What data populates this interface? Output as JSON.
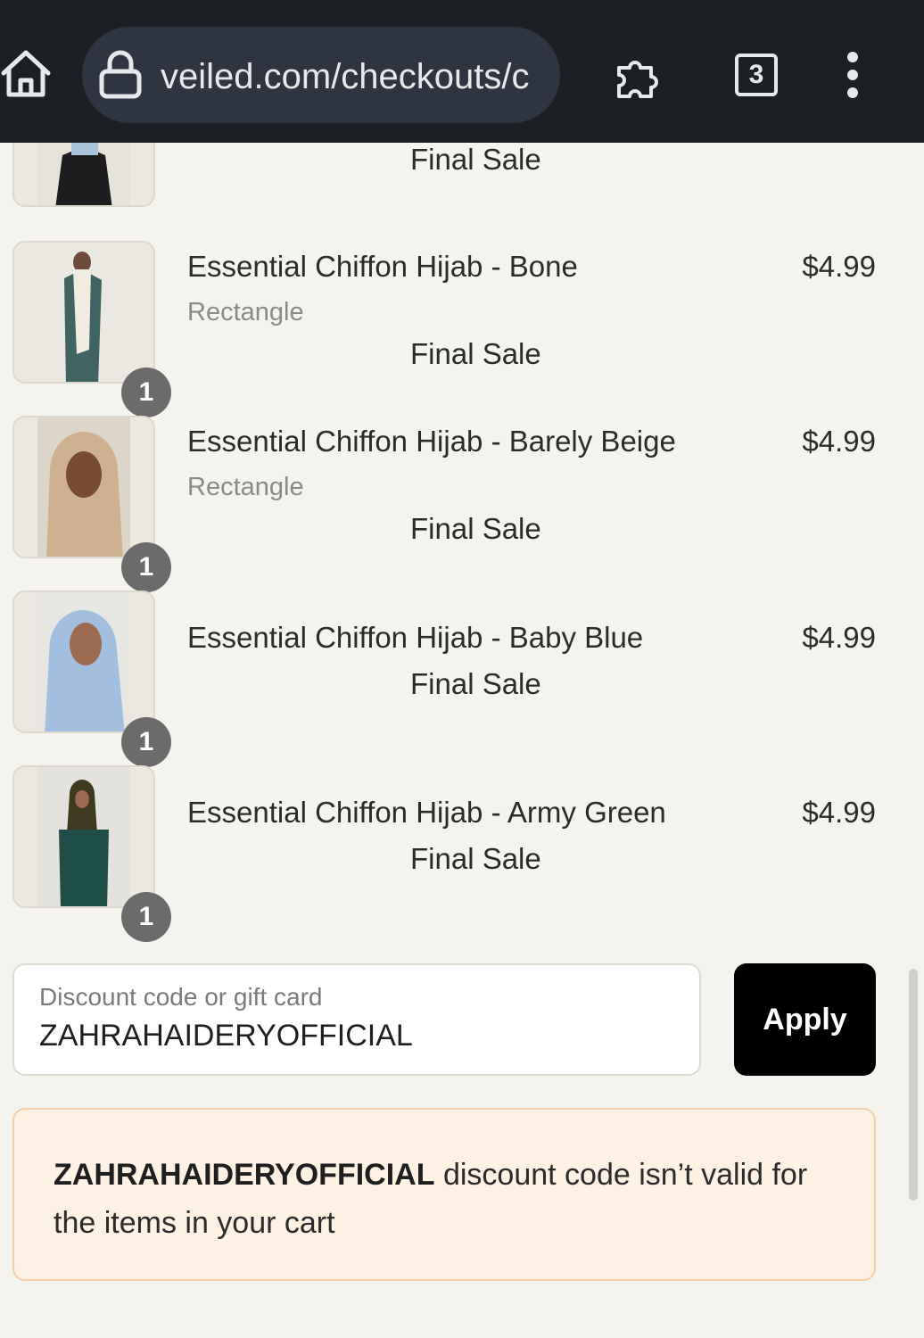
{
  "browser": {
    "url": "veiled.com/checkouts/c",
    "tab_count": "3",
    "icons": [
      "home-icon",
      "lock-icon",
      "extension-icon",
      "tabs-icon",
      "more-menu-icon"
    ]
  },
  "cart": {
    "top_partial_item": {
      "sale_label": "Final Sale"
    },
    "items": [
      {
        "quantity": "1",
        "name": "Essential Chiffon Hijab - Bone",
        "variant": "Rectangle",
        "sale_label": "Final Sale",
        "price": "$4.99"
      },
      {
        "quantity": "1",
        "name": "Essential Chiffon Hijab - Barely Beige",
        "variant": "Rectangle",
        "sale_label": "Final Sale",
        "price": "$4.99"
      },
      {
        "quantity": "1",
        "name": "Essential Chiffon Hijab - Baby Blue",
        "variant": "",
        "sale_label": "Final Sale",
        "price": "$4.99"
      },
      {
        "quantity": "1",
        "name": "Essential Chiffon Hijab - Army Green",
        "variant": "",
        "sale_label": "Final Sale",
        "price": "$4.99"
      }
    ]
  },
  "discount": {
    "label": "Discount code or gift card",
    "value": "ZAHRAHAIDERYOFFICIAL",
    "apply_label": "Apply"
  },
  "error": {
    "code": "ZAHRAHAIDERYOFFICIAL",
    "message": " discount code isn’t valid for the items in your cart"
  },
  "colors": {
    "page_background": "#f5f3ee",
    "browser_bar": "#1c1f24",
    "apply_button": "#000000",
    "error_background": "#fdf1e4",
    "error_border": "#f3cfa8"
  }
}
